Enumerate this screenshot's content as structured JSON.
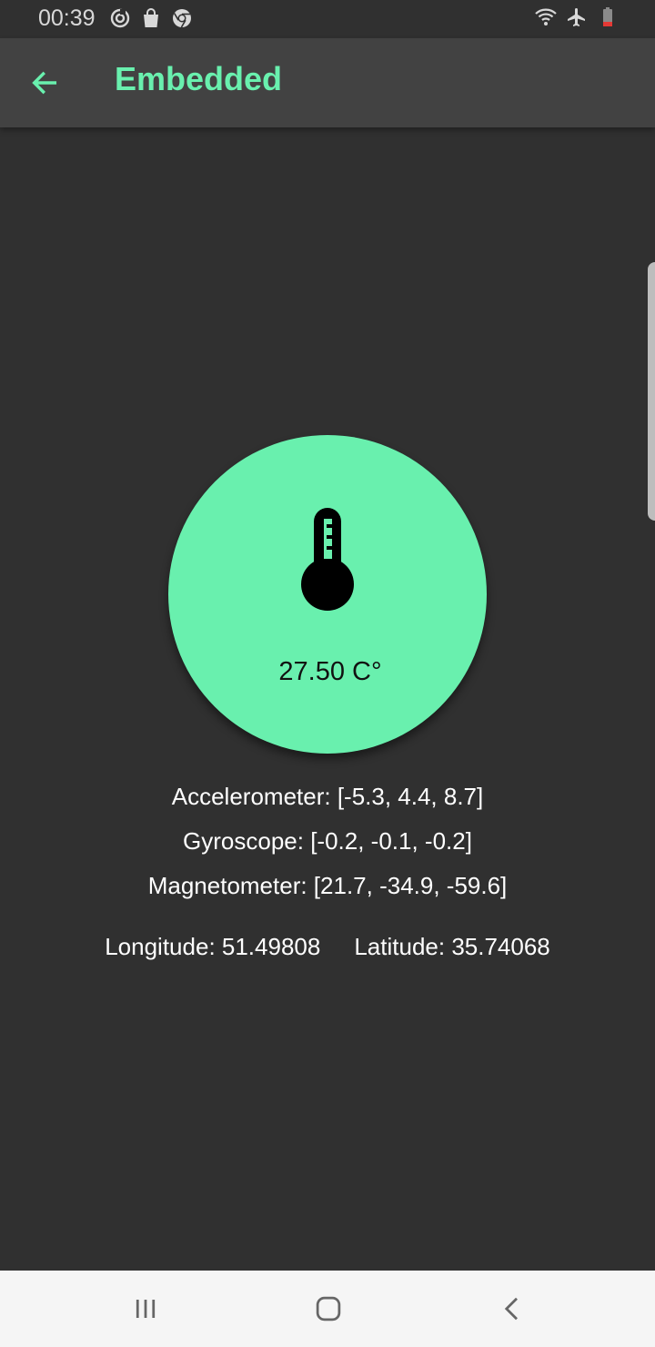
{
  "status_bar": {
    "time": "00:39",
    "icons_left": [
      "sync-icon",
      "bag-icon",
      "chrome-icon"
    ],
    "icons_right": [
      "wifi-icon",
      "airplane-icon",
      "battery-low-icon"
    ],
    "battery_color": "#e53935"
  },
  "app_bar": {
    "title": "Embedded",
    "back_icon": "arrow-left-icon",
    "accent_color": "#69f0ae"
  },
  "temperature": {
    "icon": "thermometer-icon",
    "value": "27.50 C°"
  },
  "sensors": {
    "accelerometer": "Accelerometer: [-5.3, 4.4, 8.7]",
    "gyroscope": "Gyroscope: [-0.2, -0.1, -0.2]",
    "magnetometer": "Magnetometer: [21.7, -34.9, -59.6]"
  },
  "location": {
    "longitude": "Longitude: 51.49808",
    "latitude": "Latitude: 35.74068"
  },
  "nav_bar": {
    "buttons": [
      "recents-icon",
      "home-icon",
      "back-icon"
    ]
  }
}
